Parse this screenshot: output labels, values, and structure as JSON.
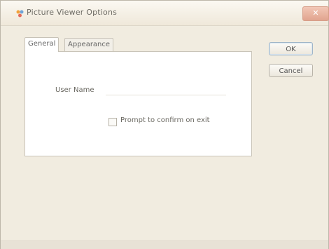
{
  "window": {
    "title": "Picture Viewer Options",
    "close_label": "✕"
  },
  "tabs": [
    {
      "label": "General",
      "selected": true
    },
    {
      "label": "Appearance",
      "selected": false
    }
  ],
  "general": {
    "username_label": "User Name",
    "username_value": "",
    "prompt_label": "Prompt to confirm on exit",
    "prompt_checked": false
  },
  "buttons": {
    "ok": "OK",
    "cancel": "Cancel"
  }
}
